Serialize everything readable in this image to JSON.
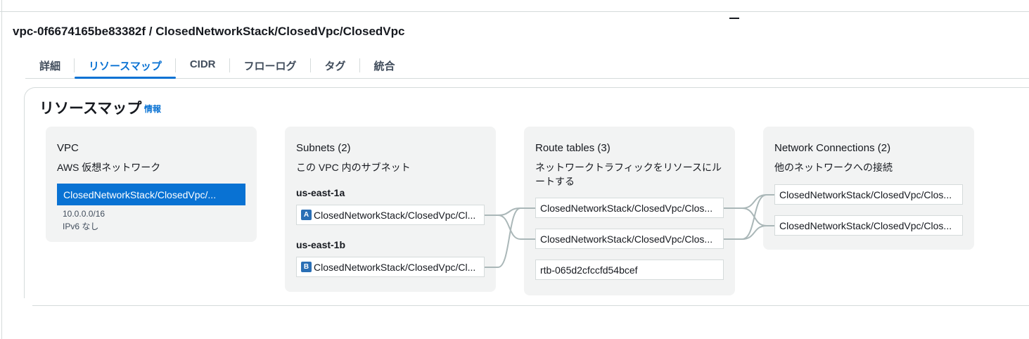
{
  "page": {
    "title": "vpc-0f6674165be83382f / ClosedNetworkStack/ClosedVpc/ClosedVpc"
  },
  "tabs": [
    {
      "label": "詳細"
    },
    {
      "label": "リソースマップ"
    },
    {
      "label": "CIDR"
    },
    {
      "label": "フローログ"
    },
    {
      "label": "タグ"
    },
    {
      "label": "統合"
    }
  ],
  "resource_map": {
    "title": "リソースマップ",
    "info_link": "情報",
    "vpc": {
      "title": "VPC",
      "subtitle": "AWS 仮想ネットワーク",
      "item": "ClosedNetworkStack/ClosedVpc/...",
      "cidr": "10.0.0.0/16",
      "ipv6": "IPv6 なし"
    },
    "subnets": {
      "title": "Subnets (2)",
      "subtitle": "この VPC 内のサブネット",
      "zones": [
        {
          "name": "us-east-1a",
          "badge": "A",
          "item": "ClosedNetworkStack/ClosedVpc/Cl..."
        },
        {
          "name": "us-east-1b",
          "badge": "B",
          "item": "ClosedNetworkStack/ClosedVpc/Cl..."
        }
      ]
    },
    "route_tables": {
      "title": "Route tables (3)",
      "subtitle_line1": "ネットワークトラフィックをリソースにル",
      "subtitle_line2": "ートする",
      "items": [
        "ClosedNetworkStack/ClosedVpc/Clos...",
        "ClosedNetworkStack/ClosedVpc/Clos...",
        "rtb-065d2cfccfd54bcef"
      ]
    },
    "network_connections": {
      "title": "Network Connections (2)",
      "subtitle": "他のネットワークへの接続",
      "items": [
        "ClosedNetworkStack/ClosedVpc/Clos...",
        "ClosedNetworkStack/ClosedVpc/Clos..."
      ]
    },
    "colors": {
      "accent": "#0972d3",
      "column_bg": "#f2f3f3",
      "connector": "#aab7b8"
    }
  }
}
